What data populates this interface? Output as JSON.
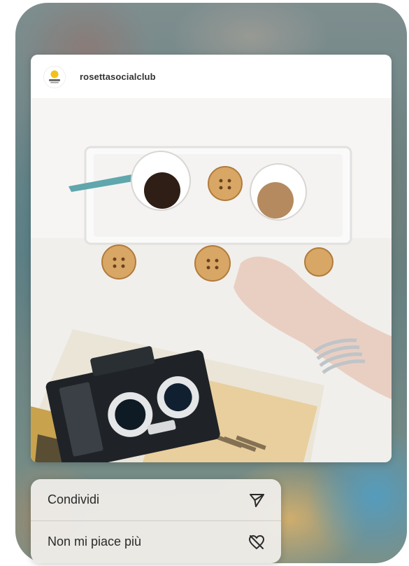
{
  "post": {
    "username": "rosettasocialclub",
    "avatar_icon": "rosetta-logo-icon"
  },
  "context_menu": {
    "items": [
      {
        "label": "Condividi",
        "icon": "send-icon"
      },
      {
        "label": "Non mi piace più",
        "icon": "unlike-heart-icon"
      }
    ]
  },
  "colors": {
    "menu_background": "#eeece8",
    "logo_yellow": "#f2c21b",
    "text": "#2a2a2a"
  }
}
